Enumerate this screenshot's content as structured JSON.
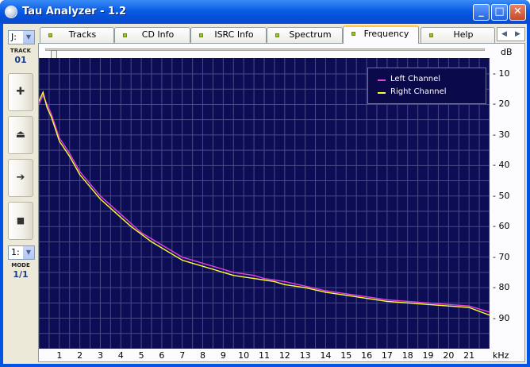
{
  "window": {
    "title": "Tau Analyzer - 1.2",
    "minimize": "_",
    "maximize": "□",
    "close": "✕"
  },
  "sidebar": {
    "drive_combo": "J:",
    "track_label": "TRACK",
    "track_number": "01",
    "buttons": [
      {
        "name": "add",
        "glyph": "✚"
      },
      {
        "name": "eject",
        "glyph": "⏏"
      },
      {
        "name": "play",
        "glyph": "➔"
      },
      {
        "name": "stop",
        "glyph": "■"
      }
    ],
    "mode_combo": "1:",
    "mode_label": "MODE",
    "mode_value": "1/1"
  },
  "tabs": [
    {
      "label": "Tracks"
    },
    {
      "label": "CD Info"
    },
    {
      "label": "ISRC Info"
    },
    {
      "label": "Spectrum"
    },
    {
      "label": "Frequency",
      "active": true
    },
    {
      "label": "Help"
    }
  ],
  "tab_scroll": {
    "left": "◀",
    "right": "▶"
  },
  "chart_data": {
    "type": "line",
    "xlabel": "kHz",
    "ylabel": "dB",
    "xlim": [
      0,
      22
    ],
    "ylim": [
      -10,
      -100
    ],
    "x_ticks": [
      "1",
      "2",
      "3",
      "4",
      "5",
      "6",
      "7",
      "8",
      "9",
      "10",
      "11",
      "12",
      "13",
      "14",
      "15",
      "16",
      "17",
      "18",
      "19",
      "20",
      "21"
    ],
    "y_ticks": [
      "- 10",
      "- 20",
      "- 30",
      "- 40",
      "- 50",
      "- 60",
      "- 70",
      "- 80",
      "- 90"
    ],
    "grid": true,
    "legend": "top-right",
    "series": [
      {
        "name": "Left Channel",
        "color": "#e040e0",
        "x": [
          0,
          0.2,
          0.4,
          0.6,
          0.8,
          1,
          1.5,
          2,
          2.5,
          3,
          3.5,
          4,
          4.5,
          5,
          5.5,
          6,
          6.5,
          7,
          7.5,
          8,
          8.5,
          9,
          9.5,
          10,
          10.5,
          11,
          11.5,
          12,
          13,
          14,
          15,
          16,
          17,
          18,
          19,
          20,
          21,
          22
        ],
        "y": [
          -20,
          -17,
          -20,
          -23,
          -27,
          -31,
          -36,
          -42,
          -46,
          -50,
          -53,
          -56,
          -59,
          -62,
          -64,
          -66,
          -68,
          -70,
          -71,
          -72,
          -73,
          -74,
          -75,
          -75.5,
          -76,
          -77,
          -77.5,
          -78,
          -79.5,
          -81,
          -82,
          -83,
          -84,
          -84.5,
          -85,
          -85.5,
          -86,
          -88
        ]
      },
      {
        "name": "Right Channel",
        "color": "#ffff30",
        "x": [
          0,
          0.2,
          0.4,
          0.6,
          0.8,
          1,
          1.5,
          2,
          2.5,
          3,
          3.5,
          4,
          4.5,
          5,
          5.5,
          6,
          6.5,
          7,
          7.5,
          8,
          8.5,
          9,
          9.5,
          10,
          10.5,
          11,
          11.5,
          12,
          13,
          14,
          15,
          16,
          17,
          18,
          19,
          20,
          21,
          22
        ],
        "y": [
          -19,
          -16,
          -21,
          -24,
          -28,
          -32,
          -37,
          -43,
          -47,
          -51,
          -54,
          -57,
          -60,
          -62.5,
          -65,
          -67,
          -69,
          -71,
          -72,
          -73,
          -74,
          -75,
          -76,
          -76.5,
          -77,
          -77.5,
          -78,
          -79,
          -80,
          -81.5,
          -82.5,
          -83.5,
          -84.5,
          -85,
          -85.5,
          -86,
          -86.5,
          -89
        ]
      }
    ]
  }
}
